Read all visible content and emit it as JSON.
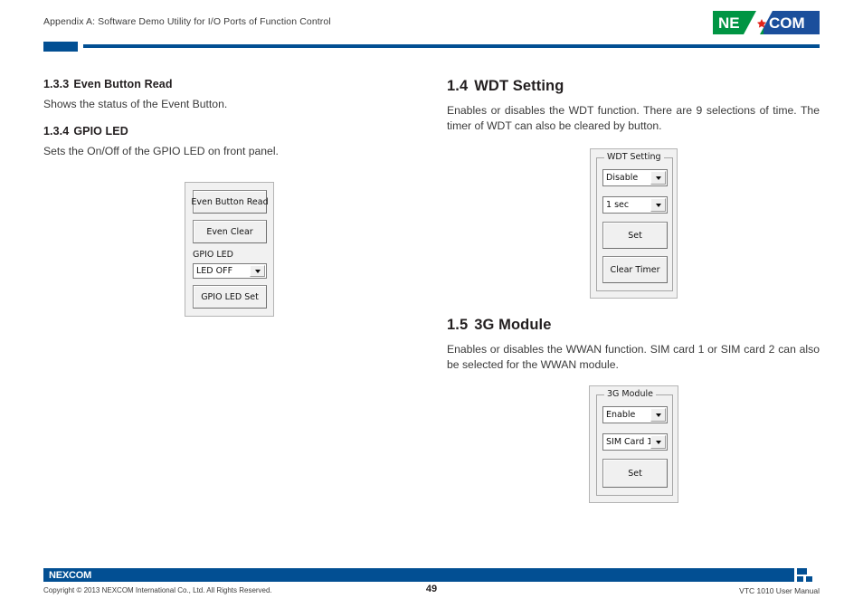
{
  "header": {
    "breadcrumb": "Appendix A: Software Demo Utility for I/O Ports of Function Control",
    "logo": {
      "left_text": "NE",
      "right_text": "COM",
      "green": "#009543",
      "blue": "#1b4f9c",
      "accent_red": "#e2231a"
    },
    "rule_color": "#024f93"
  },
  "left_column": {
    "section_even_button": {
      "number": "1.3.3",
      "title": "Even Button Read",
      "body": "Shows the status of the Event Button."
    },
    "section_gpio_led": {
      "number": "1.3.4",
      "title": "GPIO LED",
      "body": "Sets the On/Off of the GPIO LED on front panel."
    },
    "gpio_dialog": {
      "even_button_read_label": "Even Button Read",
      "even_clear_label": "Even Clear",
      "gpio_led_label": "GPIO LED",
      "led_state_value": "LED OFF",
      "gpio_led_set_label": "GPIO LED Set"
    }
  },
  "right_column": {
    "section_wdt": {
      "number": "1.4",
      "title": "WDT Setting",
      "body": "Enables or disables the WDT function. There are 9 selections of time. The timer of WDT can also be cleared by button."
    },
    "wdt_dialog": {
      "group_title": "WDT Setting",
      "enable_value": "Disable",
      "time_value": "1 sec",
      "set_label": "Set",
      "clear_timer_label": "Clear Timer"
    },
    "section_3g": {
      "number": "1.5",
      "title": "3G Module",
      "body": "Enables or disables the WWAN function. SIM card 1 or SIM card 2 can also be selected for the WWAN module."
    },
    "module_3g_dialog": {
      "group_title": "3G Module",
      "enable_value": "Enable",
      "sim_value": "SIM Card 1",
      "set_label": "Set"
    }
  },
  "footer": {
    "logo_text": "NEXCOM",
    "copyright": "Copyright © 2013 NEXCOM International Co., Ltd. All Rights Reserved.",
    "page_number": "49",
    "manual_name": "VTC 1010 User Manual",
    "bar_color": "#024f93"
  }
}
